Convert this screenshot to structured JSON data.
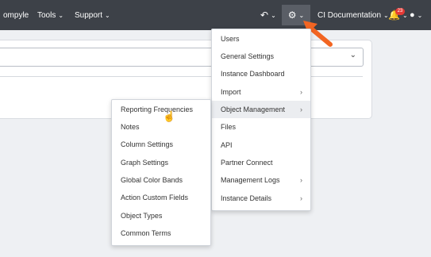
{
  "header": {
    "brand_partial": "ompyle",
    "nav": [
      {
        "label": "Tools"
      },
      {
        "label": "Support"
      }
    ],
    "workspace": "CI Documentation",
    "notification_count": "23"
  },
  "admin_menu": {
    "items": [
      {
        "label": "Users"
      },
      {
        "label": "General Settings"
      },
      {
        "label": "Instance Dashboard"
      },
      {
        "label": "Import"
      },
      {
        "label": "Object Management"
      },
      {
        "label": "Files"
      },
      {
        "label": "API"
      },
      {
        "label": "Partner Connect"
      },
      {
        "label": "Management Logs"
      },
      {
        "label": "Instance Details"
      }
    ]
  },
  "object_submenu": {
    "items": [
      {
        "label": "Reporting Frequencies"
      },
      {
        "label": "Notes"
      },
      {
        "label": "Column Settings"
      },
      {
        "label": "Graph Settings"
      },
      {
        "label": "Global Color Bands"
      },
      {
        "label": "Action Custom Fields"
      },
      {
        "label": "Object Types"
      },
      {
        "label": "Common Terms"
      }
    ]
  },
  "colors": {
    "topbar": "#3d4148",
    "annotation_arrow": "#f26522",
    "badge": "#e53935"
  }
}
